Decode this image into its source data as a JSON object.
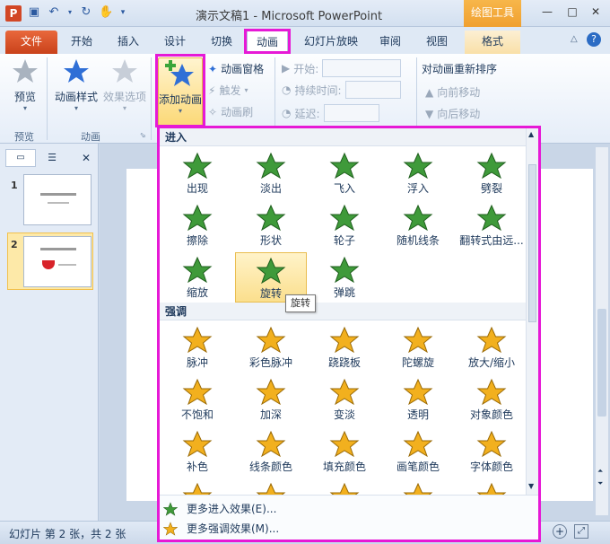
{
  "titlebar": {
    "app_icon": "P",
    "title": "演示文稿1 - Microsoft PowerPoint",
    "tool_tab": "绘图工具",
    "qat_icons": [
      "save-icon",
      "undo-icon",
      "redo-icon",
      "format-painter-icon"
    ]
  },
  "tabs": {
    "file": "文件",
    "home": "开始",
    "insert": "插入",
    "design": "设计",
    "transitions": "切换",
    "animations": "动画",
    "slideshow": "幻灯片放映",
    "review": "审阅",
    "view": "视图",
    "format": "格式"
  },
  "ribbon": {
    "preview": "预览",
    "group_preview": "预览",
    "anim_styles": "动画样式",
    "effect_options": "效果选项",
    "group_animation": "动画",
    "add_animation": "添加动画",
    "animation_pane": "动画窗格",
    "trigger": "触发",
    "anim_painter": "动画刷",
    "start": "开始:",
    "duration": "持续时间:",
    "delay": "延迟:",
    "reorder": "对动画重新排序",
    "move_earlier": "向前移动",
    "move_later": "向后移动"
  },
  "slides": [
    {
      "num": "1"
    },
    {
      "num": "2"
    }
  ],
  "gallery": {
    "entrance_header": "进入",
    "emphasis_header": "强调",
    "entrance": [
      "出现",
      "淡出",
      "飞入",
      "浮入",
      "劈裂",
      "擦除",
      "形状",
      "轮子",
      "随机线条",
      "翻转式由远...",
      "缩放",
      "旋转",
      "弹跳"
    ],
    "emphasis": [
      "脉冲",
      "彩色脉冲",
      "跷跷板",
      "陀螺旋",
      "放大/缩小",
      "不饱和",
      "加深",
      "变淡",
      "透明",
      "对象颜色",
      "补色",
      "线条颜色",
      "填充颜色",
      "画笔颜色",
      "字体颜色"
    ],
    "tooltip": "旋转",
    "more_entrance": "更多进入效果(E)...",
    "more_emphasis": "更多强调效果(M)..."
  },
  "status": {
    "slide_info": "幻灯片 第 2 张，共 2 张"
  },
  "colors": {
    "highlight": "#e619d6",
    "star_green": "#3f9a3a",
    "star_gold": "#f2b01e",
    "file_tab": "#d24726"
  }
}
